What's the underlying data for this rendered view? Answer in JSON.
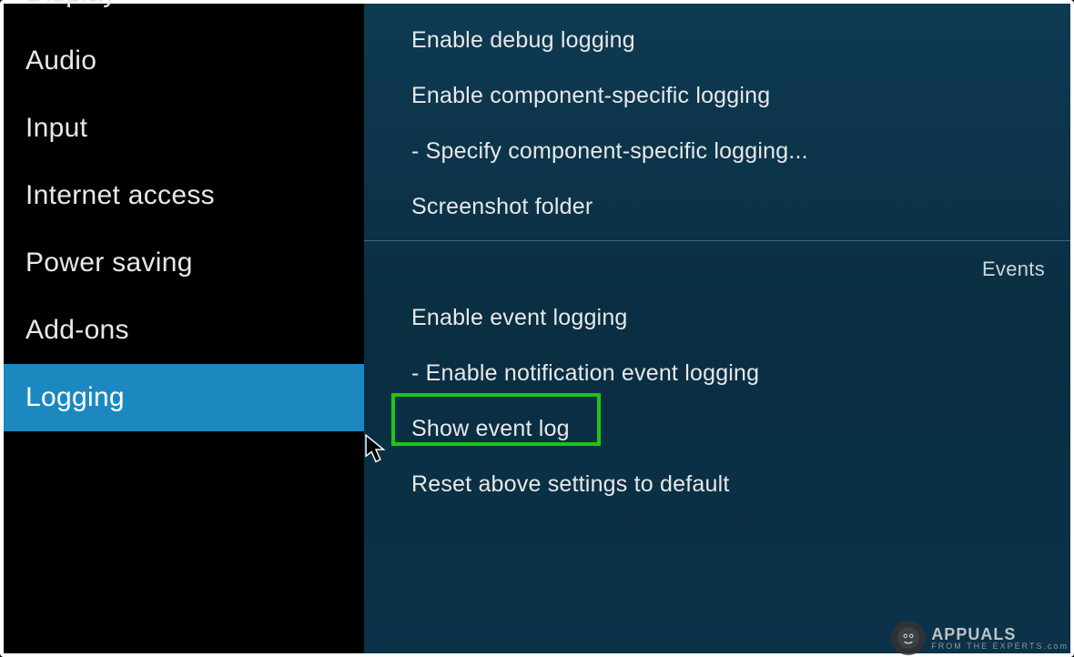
{
  "sidebar": {
    "items": [
      {
        "label": "Display",
        "partial": true
      },
      {
        "label": "Audio"
      },
      {
        "label": "Input"
      },
      {
        "label": "Internet access"
      },
      {
        "label": "Power saving"
      },
      {
        "label": "Add-ons"
      },
      {
        "label": "Logging",
        "selected": true
      }
    ]
  },
  "settings": {
    "group1": [
      "Enable debug logging",
      "Enable component-specific logging",
      "- Specify component-specific logging...",
      "Screenshot folder"
    ],
    "section_label": "Events",
    "group2": [
      "Enable event logging",
      "- Enable notification event logging",
      "Show event log",
      "Reset above settings to default"
    ]
  },
  "watermark": {
    "brand": "APPUALS",
    "tag": "FROM THE EXPERTS.com"
  }
}
